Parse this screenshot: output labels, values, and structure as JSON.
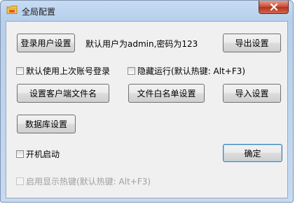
{
  "window": {
    "title": "全局配置"
  },
  "user_settings": {
    "login_user_button": "登录用户设置",
    "default_user_info": "默认用户为admin,密码为123",
    "export_button": "导出设置"
  },
  "checkboxes": {
    "use_last_account": {
      "label": "默认使用上次账号登录",
      "checked": false
    },
    "hide_running": {
      "label": "隐藏运行(默认热键: Alt+F3)",
      "checked": false
    },
    "start_on_boot": {
      "label": "开机启动",
      "checked": false
    },
    "enable_show_hotkey": {
      "label": "启用显示热键(默认热键: Alt+F3)",
      "checked": false,
      "disabled": true
    }
  },
  "buttons": {
    "client_filename": "设置客户端文件名",
    "file_whitelist": "文件白名单设置",
    "import": "导入设置",
    "database": "数据库设置",
    "ok": "确定"
  },
  "icons": {
    "app": "folder-icon",
    "close": "close-icon"
  }
}
